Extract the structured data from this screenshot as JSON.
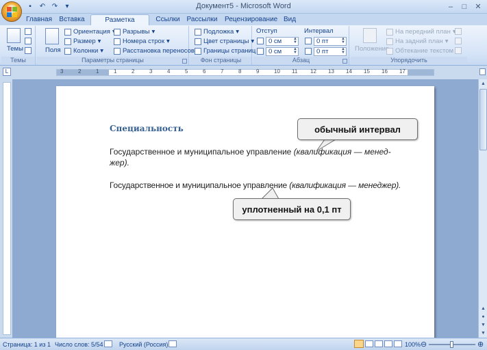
{
  "window": {
    "title": "Документ5 - Microsoft Word",
    "controls": {
      "minimize": "–",
      "maximize": "□",
      "close": "✕"
    }
  },
  "quick_access": [
    "save-icon",
    "undo-icon",
    "redo-icon",
    "customize-icon"
  ],
  "tabs": [
    {
      "label": "Главная"
    },
    {
      "label": "Вставка"
    },
    {
      "label": "Разметка страницы",
      "active": true
    },
    {
      "label": "Ссылки"
    },
    {
      "label": "Рассылки"
    },
    {
      "label": "Рецензирование"
    },
    {
      "label": "Вид"
    }
  ],
  "ribbon": {
    "themes": {
      "label": "Темы",
      "button": "Темы"
    },
    "page_setup": {
      "label": "Параметры страницы",
      "fields_button": "Поля",
      "orientation": "Ориентация",
      "size": "Размер",
      "columns": "Колонки",
      "breaks": "Разрывы",
      "line_numbers": "Номера строк",
      "hyphenation": "Расстановка переносов"
    },
    "page_background": {
      "label": "Фон страницы",
      "watermark": "Подложка",
      "page_color": "Цвет страницы",
      "page_borders": "Границы страниц"
    },
    "paragraph": {
      "label": "Абзац",
      "indent_title": "Отступ",
      "spacing_title": "Интервал",
      "indent_left": "0 см",
      "indent_right": "0 см",
      "spacing_before": "0 пт",
      "spacing_after": "0 пт"
    },
    "arrange": {
      "label": "Упорядочить",
      "position": "Положение",
      "bring_front": "На передний план",
      "send_back": "На задний план",
      "text_wrap": "Обтекание текстом"
    }
  },
  "ruler": {
    "numbers": [
      "3",
      "2",
      "1",
      "1",
      "2",
      "3",
      "4",
      "5",
      "6",
      "7",
      "8",
      "9",
      "10",
      "11",
      "12",
      "13",
      "14",
      "15",
      "16",
      "17"
    ]
  },
  "document": {
    "heading": "Специальность",
    "para1_normal": "Государственное и муниципальное управление ",
    "para1_italic_a": "(квалификация — менед-",
    "para1_italic_b": "жер).",
    "para2_normal": "Государственное и муниципальное управление ",
    "para2_italic": "(квалификация — менеджер).",
    "callout_normal": "обычный интервал",
    "callout_condensed": "уплотненный на 0,1 пт"
  },
  "statusbar": {
    "page": "Страница: 1 из 1",
    "words": "Число слов: 5/54",
    "language": "Русский (Россия)",
    "zoom": "100%",
    "zoom_fraction": 0.5
  },
  "colors": {
    "heading": "#366091",
    "ribbon_text": "#15428b",
    "doc_bg": "#8faad0",
    "callout_bg": "#f0f0f0"
  }
}
